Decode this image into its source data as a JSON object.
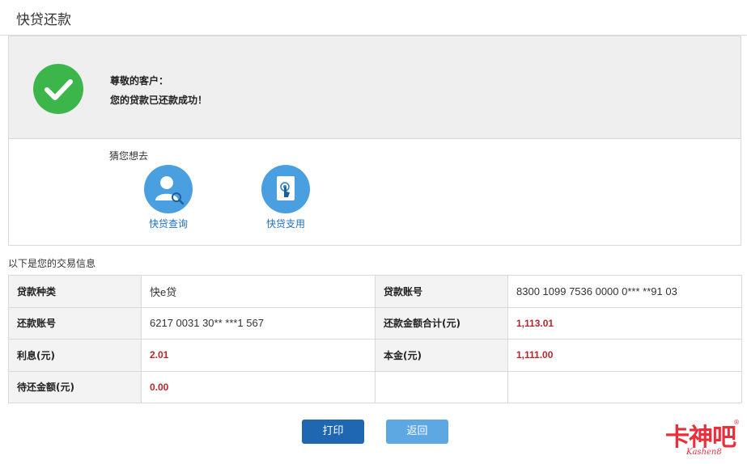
{
  "page": {
    "title": "快贷还款"
  },
  "success": {
    "greeting": "尊敬的客户：",
    "message": "您的贷款已还款成功！",
    "icon": "check-circle-icon",
    "color": "#3cb64a"
  },
  "suggest": {
    "title": "猜您想去",
    "items": [
      {
        "label": "快贷查询",
        "icon": "user-search-icon"
      },
      {
        "label": "快贷支用",
        "icon": "tap-document-icon"
      }
    ]
  },
  "transaction": {
    "caption": "以下是您的交易信息",
    "rows": [
      {
        "k1": "贷款种类",
        "v1": "快e贷",
        "k2": "贷款账号",
        "v2": "8300 1099 7536 0000 0*** **91 03"
      },
      {
        "k1": "还款账号",
        "v1": "6217 0031 30** ***1 567",
        "k2": "还款金额合计(元)",
        "v2": "1,113.01"
      },
      {
        "k1": "利息(元)",
        "v1": "2.01",
        "k2": "本金(元)",
        "v2": "1,111.00"
      },
      {
        "k1": "待还金额(元)",
        "v1": "0.00",
        "k2": "",
        "v2": ""
      }
    ]
  },
  "buttons": {
    "print": "打印",
    "back": "返回"
  },
  "watermark": {
    "text": "卡神吧",
    "sub": "Kashen8",
    "reg": "®"
  },
  "colors": {
    "primary": "#1f67b0",
    "secondary": "#5da8e2",
    "amount": "#b3282d",
    "link": "#1f6fb8"
  }
}
